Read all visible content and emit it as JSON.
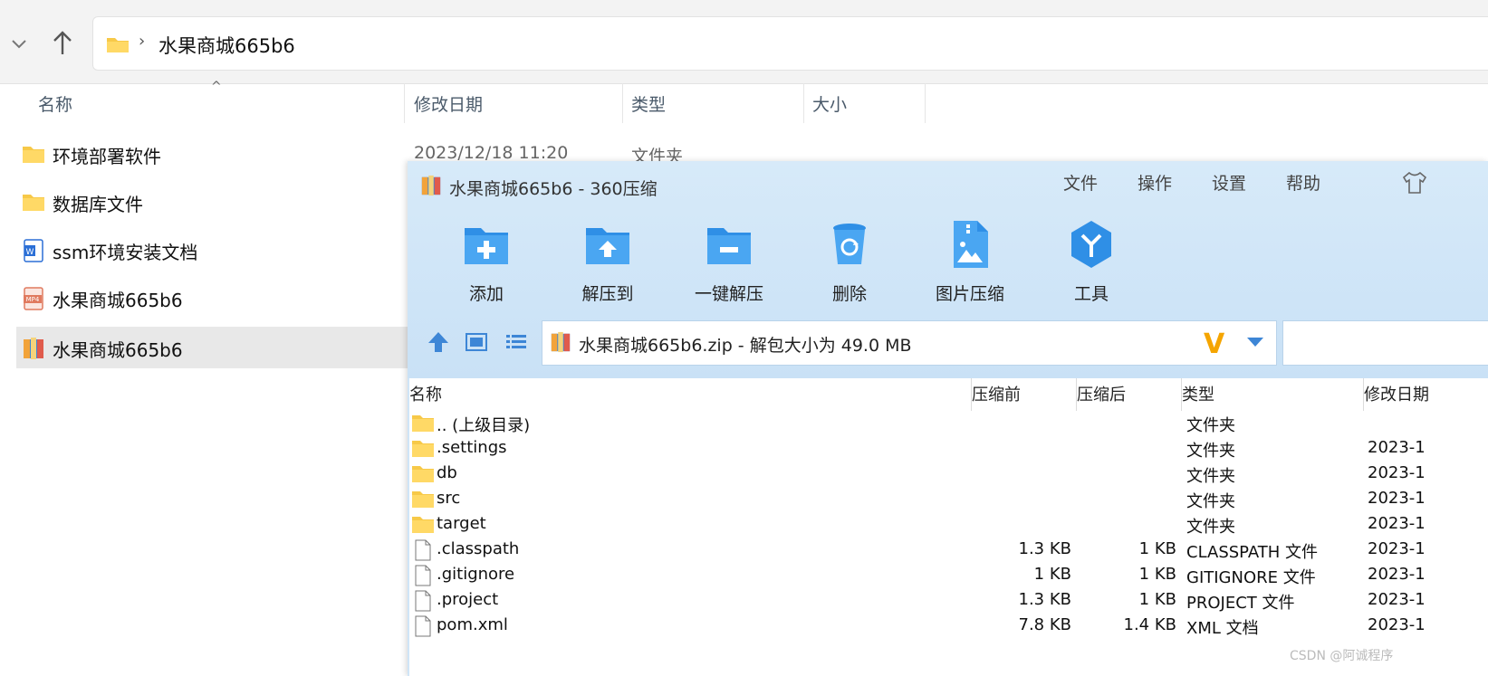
{
  "explorer": {
    "address": {
      "current_folder": "水果商城665b6",
      "separator": "›"
    },
    "columns": {
      "name": "名称",
      "modified": "修改日期",
      "type": "类型",
      "size": "大小"
    },
    "first_row_meta": {
      "modified": "2023/12/18 11:20",
      "type": "文件夹"
    },
    "items": [
      {
        "label": "环境部署软件",
        "icon": "folder-icon"
      },
      {
        "label": "数据库文件",
        "icon": "folder-icon"
      },
      {
        "label": "ssm环境安装文档",
        "icon": "word-doc-icon"
      },
      {
        "label": "水果商城665b6",
        "icon": "mp4-file-icon"
      },
      {
        "label": "水果商城665b6",
        "icon": "zip-archive-icon",
        "selected": true
      }
    ]
  },
  "zip_app": {
    "title": "水果商城665b6 - 360压缩",
    "menu": [
      "文件",
      "操作",
      "设置",
      "帮助"
    ],
    "toolbar": [
      "添加",
      "解压到",
      "一键解压",
      "删除",
      "图片压缩",
      "工具"
    ],
    "path_text": "水果商城665b6.zip - 解包大小为 49.0 MB",
    "v_mark": "V",
    "columns": {
      "name": "名称",
      "before": "压缩前",
      "after": "压缩后",
      "type": "类型",
      "modified": "修改日期"
    },
    "rows": [
      {
        "name": ".. (上级目录)",
        "before": "",
        "after": "",
        "type": "文件夹",
        "modified": "",
        "icon": "folder-icon"
      },
      {
        "name": ".settings",
        "before": "",
        "after": "",
        "type": "文件夹",
        "modified": "2023-1",
        "icon": "folder-icon"
      },
      {
        "name": "db",
        "before": "",
        "after": "",
        "type": "文件夹",
        "modified": "2023-1",
        "icon": "folder-icon"
      },
      {
        "name": "src",
        "before": "",
        "after": "",
        "type": "文件夹",
        "modified": "2023-1",
        "icon": "folder-icon"
      },
      {
        "name": "target",
        "before": "",
        "after": "",
        "type": "文件夹",
        "modified": "2023-1",
        "icon": "folder-icon"
      },
      {
        "name": ".classpath",
        "before": "1.3 KB",
        "after": "1 KB",
        "type": "CLASSPATH 文件",
        "modified": "2023-1",
        "icon": "file-icon"
      },
      {
        "name": ".gitignore",
        "before": "1 KB",
        "after": "1 KB",
        "type": "GITIGNORE 文件",
        "modified": "2023-1",
        "icon": "file-icon"
      },
      {
        "name": ".project",
        "before": "1.3 KB",
        "after": "1 KB",
        "type": "PROJECT 文件",
        "modified": "2023-1",
        "icon": "file-icon"
      },
      {
        "name": "pom.xml",
        "before": "7.8 KB",
        "after": "1.4 KB",
        "type": "XML 文档",
        "modified": "2023-1",
        "icon": "file-icon"
      }
    ]
  },
  "watermark": "CSDN @阿诚程序",
  "colors": {
    "folder": "#f7c948",
    "zip_accent": "#3d86d6",
    "selected_row": "#e8e8e8",
    "zip_bg": "#cfe5f7"
  }
}
